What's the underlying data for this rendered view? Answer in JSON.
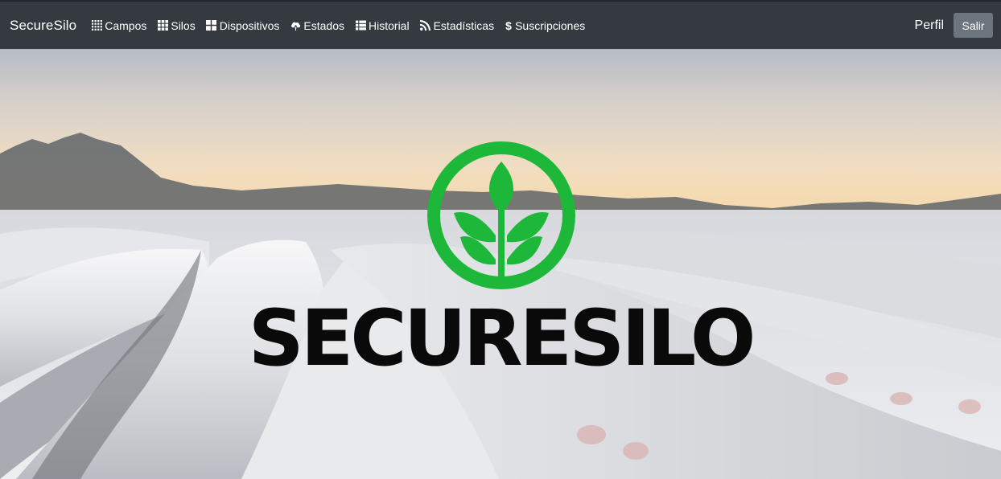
{
  "navbar": {
    "brand": "SecureSilo",
    "items": [
      {
        "label": "Campos",
        "icon": "grid-dots-icon"
      },
      {
        "label": "Silos",
        "icon": "grid-icon"
      },
      {
        "label": "Dispositivos",
        "icon": "dashboard-icon"
      },
      {
        "label": "Estados",
        "icon": "cloud-upload-icon"
      },
      {
        "label": "Historial",
        "icon": "list-icon"
      },
      {
        "label": "Estadísticas",
        "icon": "rss-icon"
      },
      {
        "label": "Suscripciones",
        "icon": "dollar-icon"
      }
    ],
    "profile_label": "Perfil",
    "logout_label": "Salir"
  },
  "hero": {
    "logo_text": "SECURESILO",
    "logo_icon": "plant-sprout-icon",
    "logo_color": "#1db83a",
    "background": "silo-bags-field-sunset"
  }
}
